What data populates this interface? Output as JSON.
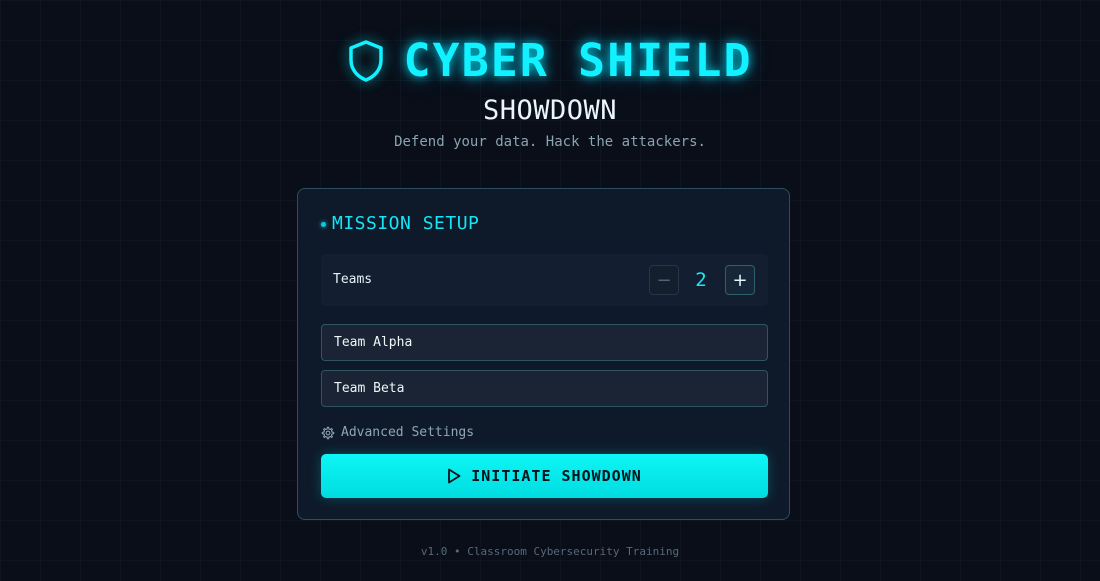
{
  "header": {
    "title": "CYBER SHIELD",
    "subtitle": "SHOWDOWN",
    "tagline": "Defend your data. Hack the attackers."
  },
  "setup": {
    "title": "MISSION SETUP",
    "teams_label": "Teams",
    "team_count": "2",
    "minus_symbol": "−",
    "plus_symbol": "+",
    "team_names": [
      "Team Alpha",
      "Team Beta"
    ],
    "advanced_label": "Advanced Settings",
    "start_label": "INITIATE SHOWDOWN"
  },
  "footer": {
    "text": "v1.0 • Classroom Cybersecurity Training"
  },
  "icons": {
    "title_icon": "shield-icon",
    "advanced_icon": "gear-icon",
    "start_icon": "play-icon"
  },
  "colors": {
    "accent": "#12f1ff",
    "background": "#090e18",
    "card": "#0e1a2a",
    "button": "#00eef0"
  }
}
